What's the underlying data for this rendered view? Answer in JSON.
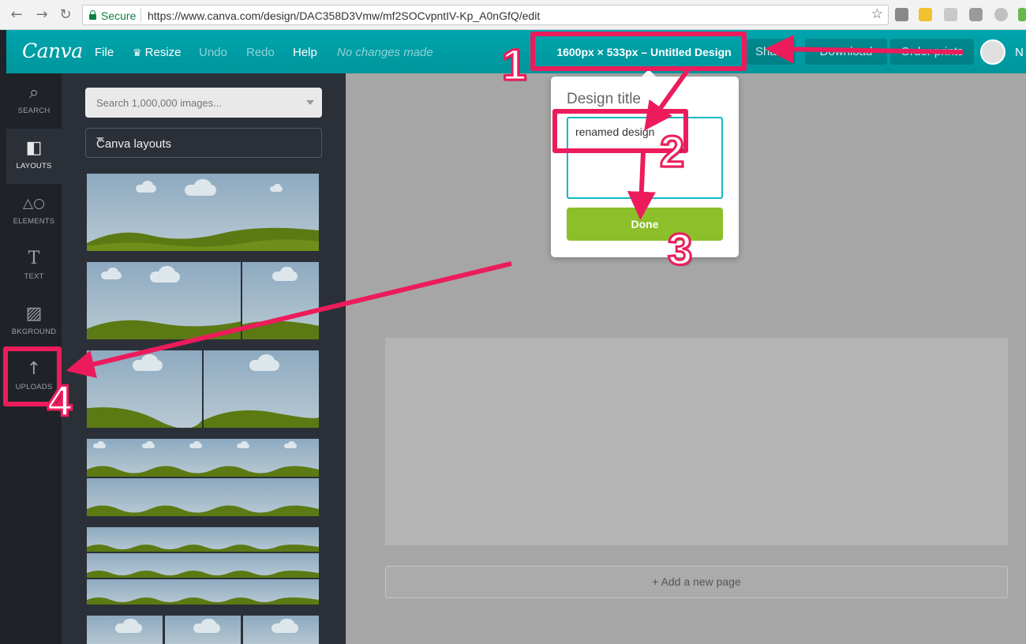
{
  "browser": {
    "back_icon": "arrow-left-icon",
    "forward_icon": "arrow-right-icon",
    "reload_icon": "reload-icon",
    "secure_label": "Secure",
    "url": "https://www.canva.com/design/DAC358D3Vmw/mf2SOCvpntIV-Kp_A0nGfQ/edit",
    "bookmark_icon": "star-icon"
  },
  "toolbar": {
    "logo": "Canva",
    "file": "File",
    "resize": "Resize",
    "undo": "Undo",
    "redo": "Redo",
    "help": "Help",
    "status": "No changes made",
    "design_title": "1600px × 533px – Untitled Design",
    "share": "Share",
    "download": "Download",
    "order_prints": "Order prints",
    "avatar_initial": "N",
    "brand_color": "#00a1a8"
  },
  "sidebar": {
    "items": [
      {
        "label": "SEARCH",
        "icon": "search-icon"
      },
      {
        "label": "LAYOUTS",
        "icon": "layouts-icon"
      },
      {
        "label": "ELEMENTS",
        "icon": "shapes-icon"
      },
      {
        "label": "TEXT",
        "icon": "text-icon"
      },
      {
        "label": "BKGROUND",
        "icon": "background-icon"
      },
      {
        "label": "UPLOADS",
        "icon": "upload-icon"
      }
    ]
  },
  "panel": {
    "search_placeholder": "Search 1,000,000 images...",
    "layout_select": "Canva layouts"
  },
  "canvas": {
    "add_page": "+ Add a new page"
  },
  "popup": {
    "title": "Design title",
    "value": "renamed design",
    "done": "Done"
  },
  "annotations": {
    "color": "#ec1c5c",
    "steps": [
      "1",
      "2",
      "3",
      "4"
    ]
  }
}
